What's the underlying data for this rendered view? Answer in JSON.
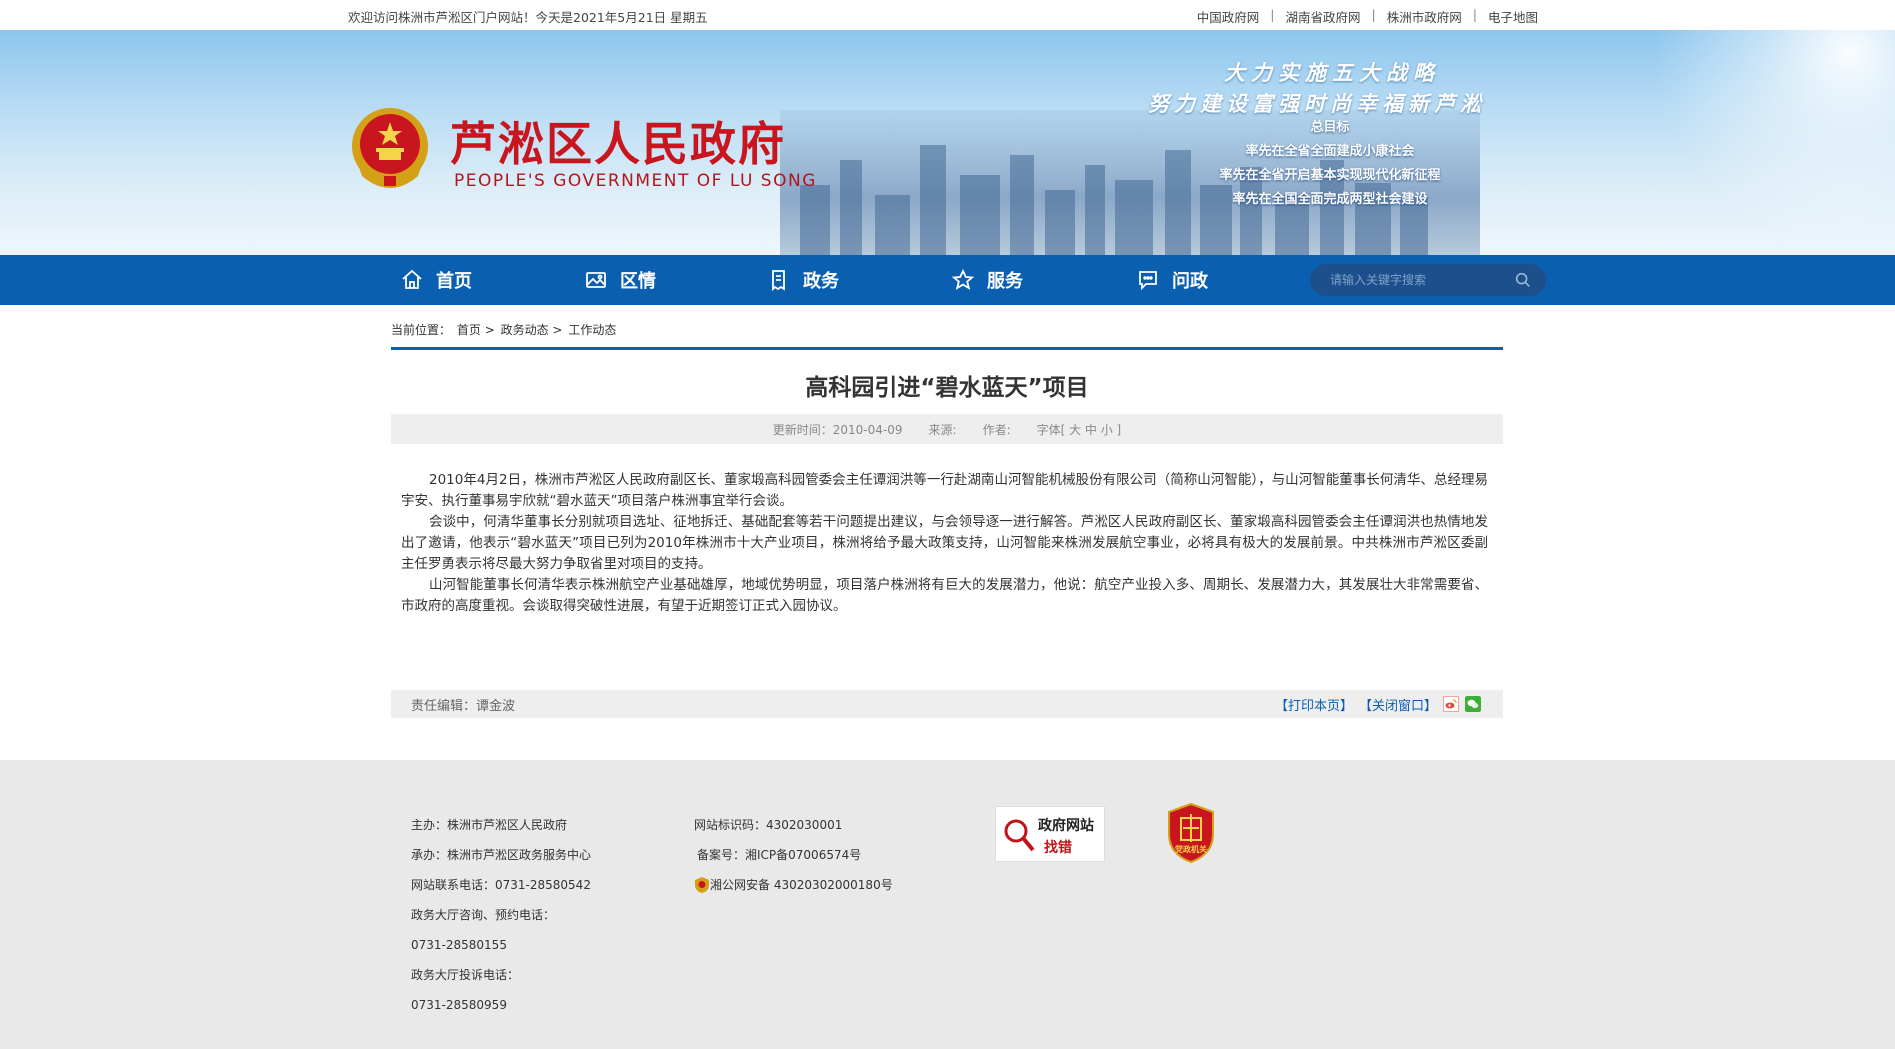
{
  "topbar": {
    "welcome": "欢迎访问株洲市芦淞区门户网站！今天是2021年5月21日 星期五",
    "links": [
      "中国政府网",
      "湖南省政府网",
      "株洲市政府网",
      "电子地图"
    ],
    "separator": "|"
  },
  "banner": {
    "title": "芦淞区人民政府",
    "subtitle": "PEOPLE'S GOVERNMENT OF  LU SONG",
    "slogan_line1": "大力实施五大战略",
    "slogan_line2": "努力建设富强时尚幸福新芦淞",
    "goals_heading": "总目标",
    "goals": [
      "率先在全省全面建成小康社会",
      "率先在全省开启基本实现现代化新征程",
      "率先在全国全面完成两型社会建设"
    ]
  },
  "nav": {
    "items": [
      {
        "label": "首页",
        "icon": "home-icon"
      },
      {
        "label": "区情",
        "icon": "image-icon"
      },
      {
        "label": "政务",
        "icon": "document-icon"
      },
      {
        "label": "服务",
        "icon": "star-icon"
      },
      {
        "label": "问政",
        "icon": "chat-icon"
      }
    ],
    "search_placeholder": "请输入关键字搜索"
  },
  "breadcrumb": {
    "prefix": "当前位置：",
    "items": [
      "首页",
      "政务动态",
      "工作动态"
    ],
    "separator": ">"
  },
  "article": {
    "title": "高科园引进“碧水蓝天”项目",
    "meta": {
      "updated": "更新时间：2010-04-09",
      "source": "来源:",
      "author": "作者:",
      "font": "字体[ 大 中 小 ]"
    },
    "paragraphs": [
      "2010年4月2日，株洲市芦淞区人民政府副区长、董家塅高科园管委会主任谭润洪等一行赴湖南山河智能机械股份有限公司（简称山河智能），与山河智能董事长何清华、总经理易宇安、执行董事易宇欣就“碧水蓝天”项目落户株洲事宜举行会谈。",
      "会谈中，何清华董事长分别就项目选址、征地拆迁、基础配套等若干问题提出建议，与会领导逐一进行解答。芦淞区人民政府副区长、董家塅高科园管委会主任谭润洪也热情地发出了邀请，他表示“碧水蓝天”项目已列为2010年株洲市十大产业项目，株洲将给予最大政策支持，山河智能来株洲发展航空事业，必将具有极大的发展前景。中共株洲市芦淞区委副主任罗勇表示将尽最大努力争取省里对项目的支持。",
      "山河智能董事长何清华表示株洲航空产业基础雄厚，地域优势明显，项目落户株洲将有巨大的发展潜力，他说：航空产业投入多、周期长、发展潜力大，其发展壮大非常需要省、市政府的高度重视。会谈取得突破性进展，有望于近期签订正式入园协议。"
    ],
    "editor": "责任编辑：谭金波",
    "print": "【打印本页】",
    "close": "【关闭窗口】"
  },
  "footer": {
    "col1": [
      "主办：株洲市芦淞区人民政府",
      "承办：株洲市芦淞区政务服务中心",
      "网站联系电话：0731-28580542",
      "政务大厅咨询、预约电话：",
      "0731-28580155",
      "政务大厅投诉电话：",
      "0731-28580959"
    ],
    "col2": [
      "网站标识码：4302030001",
      "备案号：湘ICP备07006574号",
      "湘公网安备 43020302000180号"
    ],
    "badge1_line1": "政府网站",
    "badge1_line2": "找错",
    "badge2_text": "党政机关"
  },
  "colors": {
    "nav_blue": "#0b5fb0",
    "title_red": "#c9151e",
    "footer_gray": "#e9e9e9"
  }
}
